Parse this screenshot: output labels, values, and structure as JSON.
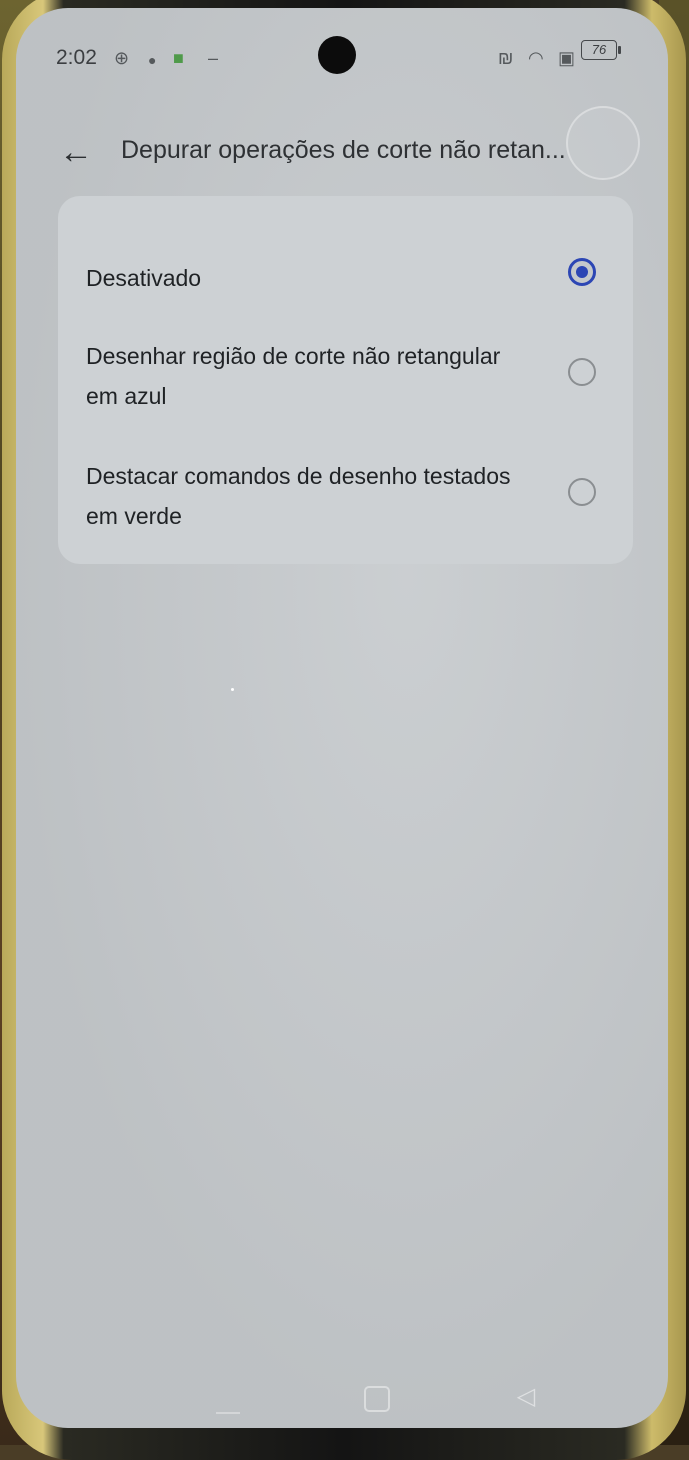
{
  "status_bar": {
    "time": "2:02",
    "battery": "76"
  },
  "header": {
    "title": "Depurar operações de corte não retan..."
  },
  "options": [
    {
      "label": "Desativado",
      "selected": true
    },
    {
      "label": "Desenhar região de corte não retangular em azul",
      "selected": false
    },
    {
      "label": "Destacar comandos de desenho testados em verde",
      "selected": false
    }
  ],
  "colors": {
    "accent": "#2c46b4",
    "background": "#c5c9cc"
  }
}
